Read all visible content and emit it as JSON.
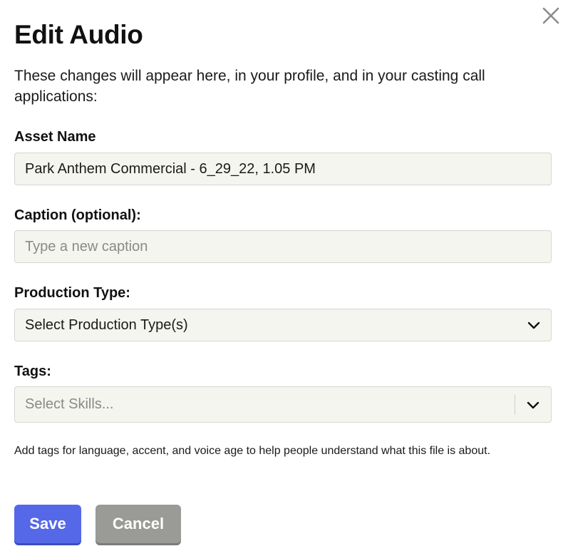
{
  "dialog": {
    "title": "Edit Audio",
    "subtitle": "These changes will appear here, in your profile, and in your casting call applications:"
  },
  "form": {
    "asset_name": {
      "label": "Asset Name",
      "value": "Park Anthem Commercial - 6_29_22, 1.05 PM"
    },
    "caption": {
      "label": "Caption (optional):",
      "placeholder": "Type a new caption"
    },
    "production_type": {
      "label": "Production Type:",
      "selected": "Select Production Type(s)"
    },
    "tags": {
      "label": "Tags:",
      "placeholder": "Select Skills...",
      "helper": "Add tags for language, accent, and voice age to help people understand what this file is about."
    }
  },
  "actions": {
    "save_label": "Save",
    "cancel_label": "Cancel"
  },
  "colors": {
    "primary": "#5468e8",
    "secondary": "#9a9a96",
    "field_bg": "#f5f5f0"
  },
  "icons": {
    "close": "close-icon",
    "dropdown": "chevron-down-icon"
  }
}
